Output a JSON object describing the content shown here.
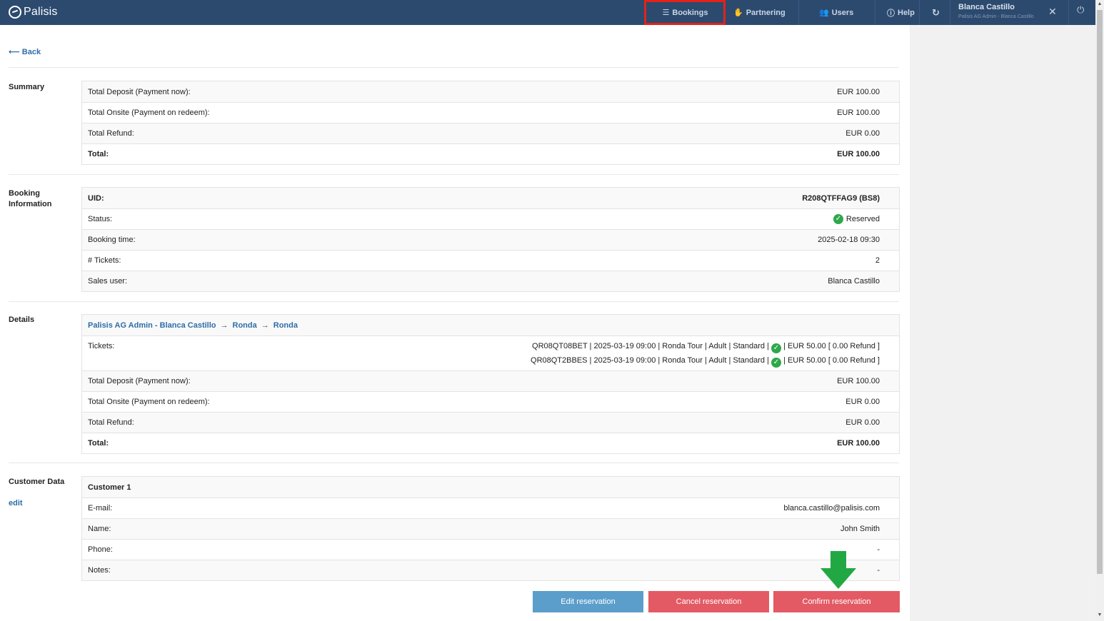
{
  "app": {
    "brand": "Palisis"
  },
  "nav": {
    "bookings": "Bookings",
    "partnering": "Partnering",
    "users": "Users",
    "help": "Help",
    "user_name": "Blanca Castillo",
    "user_sub": "Palisis AG Admin - Blanca Castillo"
  },
  "back": "Back",
  "sections": {
    "summary": "Summary",
    "booking_info_1": "Booking",
    "booking_info_2": "Information",
    "details": "Details",
    "customer": "Customer Data",
    "edit": "edit"
  },
  "summary": {
    "rows": [
      {
        "label": "Total Deposit (Payment now):",
        "value": "EUR 100.00"
      },
      {
        "label": "Total Onsite (Payment on redeem):",
        "value": "EUR 100.00"
      },
      {
        "label": "Total Refund:",
        "value": "EUR 0.00"
      },
      {
        "label": "Total:",
        "value": "EUR 100.00"
      }
    ]
  },
  "booking": {
    "uid_label": "UID:",
    "uid_value": "R208QTFFAG9 (BS8)",
    "status_label": "Status:",
    "status_value": "Reserved",
    "time_label": "Booking time:",
    "time_value": "2025-02-18 09:30",
    "tickets_label": "# Tickets:",
    "tickets_value": "2",
    "sales_label": "Sales user:",
    "sales_value": "Blanca Castillo"
  },
  "details": {
    "path_1": "Palisis AG Admin - Blanca Castillo",
    "path_2": "Ronda",
    "path_3": "Ronda",
    "tickets_label": "Tickets:",
    "ticket_1_a": "QR08QT08BET | 2025-03-19 09:00 | Ronda Tour | Adult | Standard |",
    "ticket_1_b": "| EUR 50.00 [ 0.00 Refund ]",
    "ticket_2_a": "QR08QT2BBES | 2025-03-19 09:00 | Ronda Tour | Adult | Standard |",
    "ticket_2_b": "| EUR 50.00 [ 0.00 Refund ]",
    "rows": [
      {
        "label": "Total Deposit (Payment now):",
        "value": "EUR 100.00"
      },
      {
        "label": "Total Onsite (Payment on redeem):",
        "value": "EUR 0.00"
      },
      {
        "label": "Total Refund:",
        "value": "EUR 0.00"
      },
      {
        "label": "Total:",
        "value": "EUR 100.00"
      }
    ]
  },
  "customer": {
    "title": "Customer 1",
    "email_label": "E-mail:",
    "email_value": "blanca.castillo@palisis.com",
    "name_label": "Name:",
    "name_value": "John Smith",
    "phone_label": "Phone:",
    "phone_value": "-",
    "notes_label": "Notes:",
    "notes_value": "-"
  },
  "buttons": {
    "edit": "Edit reservation",
    "cancel": "Cancel reservation",
    "confirm": "Confirm reservation"
  },
  "colors": {
    "navbar": "#2c4a6e",
    "highlight": "#e2231a",
    "link": "#2d6da8",
    "edit_button": "#5b9ecb",
    "danger_button": "#e35a64",
    "status_ok": "#2ea84a",
    "arrow": "#22a843"
  }
}
